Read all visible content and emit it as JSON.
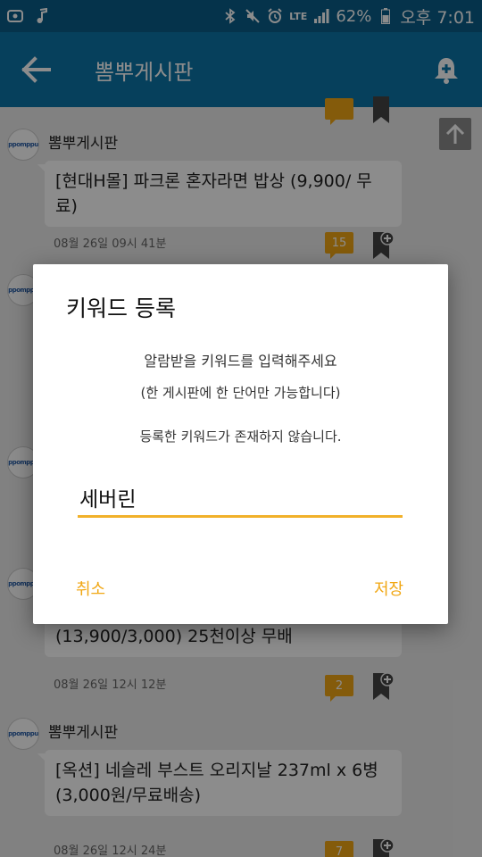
{
  "status_bar": {
    "battery": "62%",
    "network": "LTE",
    "time": "오후 7:01"
  },
  "app_bar": {
    "title": "뽐뿌게시판"
  },
  "feed": {
    "posts": [
      {
        "board": "뽐뿌게시판",
        "title": "[현대H몰] 파크론 혼자라면 밥상 (9,900/ 무료)",
        "date": "08월 26일 09시 41분",
        "comments": "15"
      },
      {
        "board": "",
        "title": "[티몬] 페브리즈 차량용 방향제 13통(13,900/3,000) 25천이상 무배",
        "date": "08월 26일 12시 12분",
        "comments": "2"
      },
      {
        "board": "뽐뿌게시판",
        "title": "[옥션] 네슬레 부스트 오리지날 237ml x 6병 (3,000원/무료배송)",
        "date": "08월 26일 12시 24분",
        "comments": "7"
      }
    ]
  },
  "dialog": {
    "title": "키워드 등록",
    "line1": "알람받을 키워드를 입력해주세요",
    "line2": "(한 게시판에 한 단어만 가능합니다)",
    "line3": "등록한 키워드가 존재하지 않습니다.",
    "input_value": "세버린",
    "cancel_label": "취소",
    "save_label": "저장"
  },
  "colors": {
    "status_bar": "#0a5e89",
    "app_bar": "#0b75a8",
    "accent": "#f1a714"
  }
}
